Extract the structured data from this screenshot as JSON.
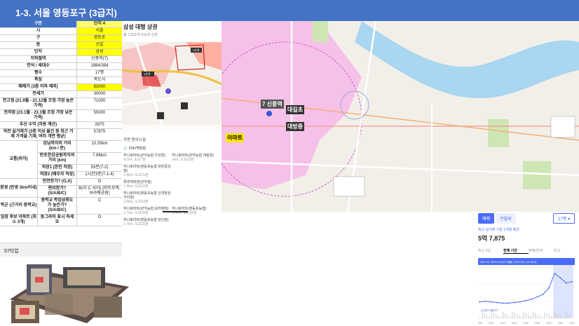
{
  "title": "1-3. 서울 영등포구 (3급지)",
  "table": {
    "header": {
      "label": "구분",
      "value": "단지 4"
    },
    "rows": [
      {
        "label": "시",
        "value": "서울",
        "hl": true
      },
      {
        "label": "구",
        "value": "영등포",
        "hl": true
      },
      {
        "label": "동",
        "value": "신길",
        "hl": true
      },
      {
        "label": "단지",
        "value": "삼성",
        "hl": true
      },
      {
        "label": "지하철역",
        "value": "신풍역(7)",
        "hl": false
      },
      {
        "label": "연식 / 세대수",
        "value": "1984/384",
        "hl": false
      },
      {
        "label": "평수",
        "value": "17평",
        "hl": false
      },
      {
        "label": "특징",
        "value": "복도식",
        "hl": false
      },
      {
        "label": "매매가 (3층 이하 제외)",
        "value": "63000",
        "hl": true
      },
      {
        "label": "전세가",
        "value": "30000",
        "hl": false
      },
      {
        "label": "전고점 (21.9월 - 21.12월 조정 가장 높은 가격)",
        "value": "71000",
        "hl": false
      },
      {
        "label": "전저점 (23.1월 - 23.3월 조정 가장 낮은 가격)",
        "value": "55000",
        "hl": false
      },
      {
        "label": "추산 수익 (자동 계산)",
        "value": "2875",
        "hl": false
      },
      {
        "label": "직전 실거래가 (3층 이상 물건 중 최근 거래 가격을 기재, 여러 개면 평균)",
        "value": "57875",
        "hl": false
      }
    ],
    "transport": {
      "label": "교통(위치)",
      "rows": [
        {
          "label": "강남까지의 거리 (km / 분)",
          "value": "10.29km"
        },
        {
          "label": "반포한강공원까지의 거리 (km)",
          "value": "7.86km"
        },
        {
          "label": "직장1 (본인 직장)",
          "value": "53분(7-2)"
        },
        {
          "label": "직장2 (배우자 직장)",
          "value": "1시간3분(7-1-4)"
        }
      ]
    },
    "env": {
      "label": "환경 (반경 3km이내)",
      "rows": [
        {
          "label": "안전한가? (O,X)",
          "value": "O"
        },
        {
          "label": "편리한가? (S/A/B/C)",
          "value": "B(이 C 사이) (마트부족, 보라매공원)"
        }
      ]
    },
    "school": {
      "label": "학군 (근거리 중학교)",
      "sub": "중학교 학업성취도가 높은가? (S/A/B/C)",
      "value": "C"
    },
    "alt": {
      "label": "임장 후보 아파트 (최소 3개)",
      "sub": "동그라미 표시 하세요",
      "value": "O"
    }
  },
  "type_label": "57타입",
  "store": {
    "title": "삼성 대형 상권",
    "subtitle": "총 1,562개 규모의 상권",
    "facilities_header": "주변 편의시설",
    "category": "마트/백화점",
    "items": [
      {
        "name": "하나로마트(관악농협 우성점)",
        "dist": "472m, 도보7분"
      },
      {
        "name": "하나로마트(관악농협 대림점)",
        "dist": "1km, 도보15분"
      },
      {
        "name": "하나로마트(영등포농협 대방중앙점)",
        "dist": "1.4km, 도보21분"
      },
      {
        "name": "",
        "dist": ""
      },
      {
        "name": "롯데백화점(관악점)",
        "dist": "1.4km, 도보21분"
      },
      {
        "name": "",
        "dist": ""
      },
      {
        "name": "하나로마트(영등포농협 신대방삼거리점)",
        "dist": "1.6km, 도보23분"
      },
      {
        "name": "",
        "dist": ""
      },
      {
        "name": "하나로마트(관악농협 보라매점)",
        "dist": "1.7km, 도보26분"
      },
      {
        "name": "하나로마트(영등포농협)",
        "dist": "1.8km, 도보26분"
      },
      {
        "name": "하나로마트(영등포농협 당산점)",
        "dist": "1.7km, 도보26분"
      },
      {
        "name": "",
        "dist": ""
      }
    ],
    "minimap_labels": [
      "1순위",
      "2순위"
    ]
  },
  "map": {
    "labels": {
      "station": "7 신풍역",
      "school1": "대길초",
      "school2": "대방중",
      "mart": "이마트"
    },
    "colors": {
      "zone": "#f7b8e8",
      "river": "#a9d6f0",
      "park": "#cde6b3"
    }
  },
  "price": {
    "tab_on": "매매",
    "tab_off": "전월세",
    "select": "17평",
    "desc": "최근 실거래 기준 1개월 평균",
    "value": "5억 7,875",
    "period_tabs": [
      "최근 3년",
      "전체 기간",
      "매매/전세",
      "비교"
    ],
    "period_active": 1,
    "tooltip": "2021.11~2024.04 (3년 5개월) -1억 6,000 (-22.54%)",
    "legend": "실거래가 매물보기",
    "x_ticks": [
      "2008",
      "2010",
      "2012",
      "2014",
      "2016",
      "2018",
      "2020",
      "2022",
      "2024"
    ],
    "color": "#4a6cf7"
  },
  "chart_data": {
    "type": "line",
    "x": [
      "2008",
      "2009",
      "2010",
      "2011",
      "2012",
      "2013",
      "2014",
      "2015",
      "2016",
      "2017",
      "2018",
      "2019",
      "2020",
      "2021",
      "2022",
      "2023",
      "2024"
    ],
    "values": [
      2.6,
      2.7,
      2.6,
      2.5,
      2.4,
      2.4,
      2.5,
      2.6,
      2.8,
      3.0,
      3.4,
      3.8,
      4.8,
      7.1,
      6.4,
      5.6,
      5.8
    ],
    "ylim": [
      0,
      8
    ]
  }
}
